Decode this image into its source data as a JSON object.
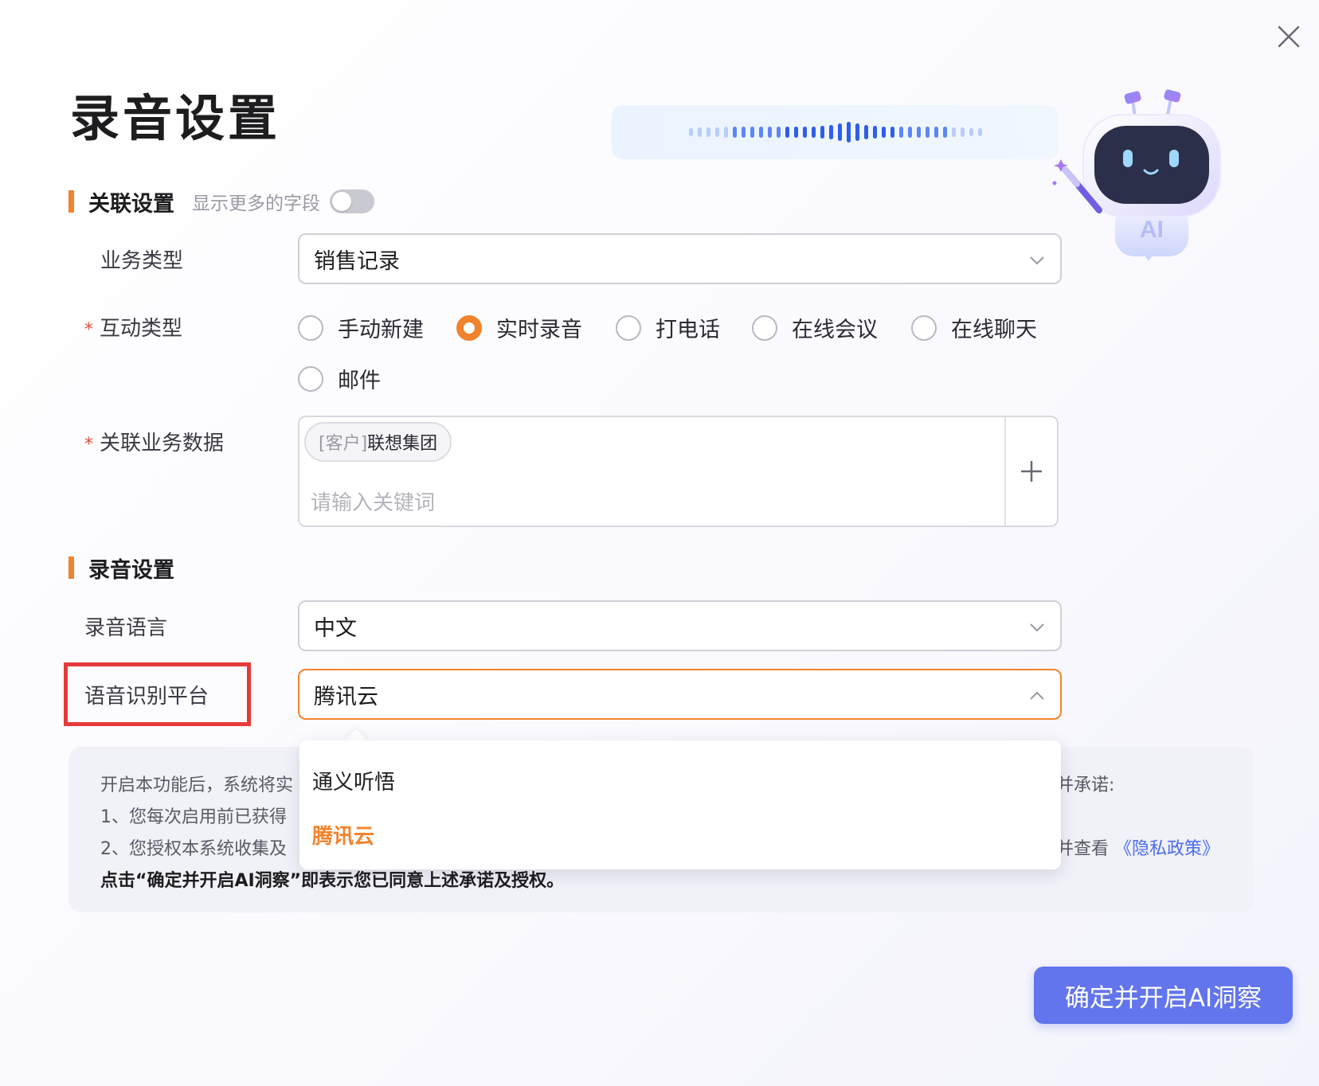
{
  "dialog": {
    "title": "录音设置",
    "confirm_label": "确定并开启AI洞察",
    "mascot_badge": "AI"
  },
  "section_association": {
    "title": "关联设置",
    "hint": "显示更多的字段",
    "toggle_on": false
  },
  "business_type": {
    "label": "业务类型",
    "value": "销售记录"
  },
  "interaction_type": {
    "label": "互动类型",
    "required_mark": "*",
    "options": [
      "手动新建",
      "实时录音",
      "打电话",
      "在线会议",
      "在线聊天",
      "邮件"
    ],
    "selected": "实时录音"
  },
  "related_data": {
    "label": "关联业务数据",
    "required_mark": "*",
    "tag_prefix": "[客户]",
    "tag_name": "联想集团",
    "placeholder": "请输入关键词"
  },
  "section_recording": {
    "title": "录音设置"
  },
  "recording_language": {
    "label": "录音语言",
    "value": "中文"
  },
  "asr_platform": {
    "label": "语音识别平台",
    "value": "腾讯云",
    "options": [
      "通义听悟",
      "腾讯云"
    ],
    "selected": "腾讯云"
  },
  "notice": {
    "line1_start": "开启本功能后，系统将实",
    "line1_end": "并承诺:",
    "line2_start": "1、您每次启用前已获得",
    "line3_start": "2、您授权本系统收集及",
    "line3_end": "并查看",
    "privacy_link": "《隐私政策》",
    "line4": "点击“确定并开启AI洞察”即表示您已同意上述承诺及授权。"
  },
  "colors": {
    "accent": "#f2832d",
    "primary_button": "#6275ec",
    "highlight": "#e63a3a",
    "link": "#4a6cf0",
    "required": "#e24b3b"
  }
}
